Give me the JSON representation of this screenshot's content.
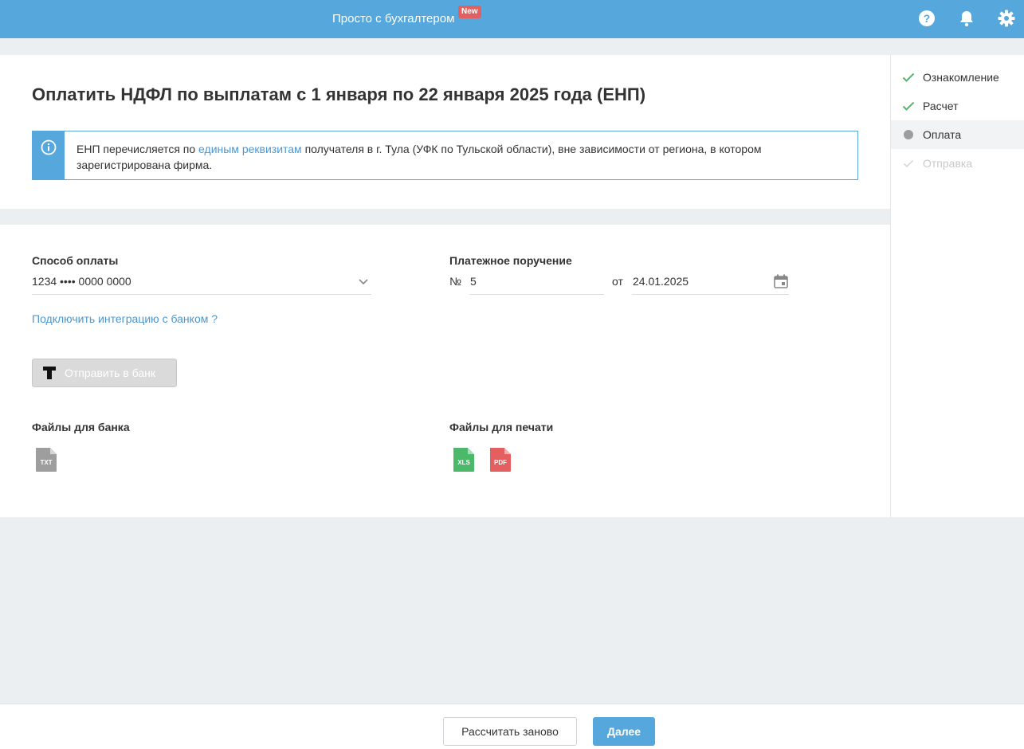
{
  "header": {
    "app_title": "Просто с бухгалтером",
    "badge": "New",
    "icons": [
      "help-icon",
      "bell-icon",
      "gear-icon"
    ]
  },
  "page": {
    "title": "Оплатить НДФЛ по выплатам с 1 января по 22 января 2025 года (ЕНП)"
  },
  "info": {
    "text_before": "ЕНП перечисляется по ",
    "link": "единым реквизитам",
    "text_after": " получателя в г. Тула (УФК по Тульской области), вне зависимости от региона, в котором зарегистрирована фирма."
  },
  "payment": {
    "method_label": "Способ оплаты",
    "method_value": "1234 •••• 0000 0000",
    "bank_integration_link": "Подключить интеграцию с банком ?",
    "order_label": "Платежное поручение",
    "number_prefix": "№",
    "number_value": "5",
    "date_prefix": "от",
    "date_value": "24.01.2025",
    "send_button": "Отправить в банк"
  },
  "files": {
    "bank_label": "Файлы для банка",
    "bank_files": [
      "TXT"
    ],
    "print_label": "Файлы для печати",
    "print_files": [
      "XLS",
      "PDF"
    ]
  },
  "steps": [
    {
      "label": "Ознакомление",
      "state": "done"
    },
    {
      "label": "Расчет",
      "state": "done"
    },
    {
      "label": "Оплата",
      "state": "current"
    },
    {
      "label": "Отправка",
      "state": "pending"
    }
  ],
  "footer": {
    "recalc_button": "Рассчитать заново",
    "next_button": "Далее"
  },
  "colors": {
    "primary": "#55a7dc",
    "success": "#4cb86a",
    "badge": "#e46060",
    "xls": "#4cb86a",
    "pdf": "#e46060",
    "txt": "#9e9e9e"
  }
}
